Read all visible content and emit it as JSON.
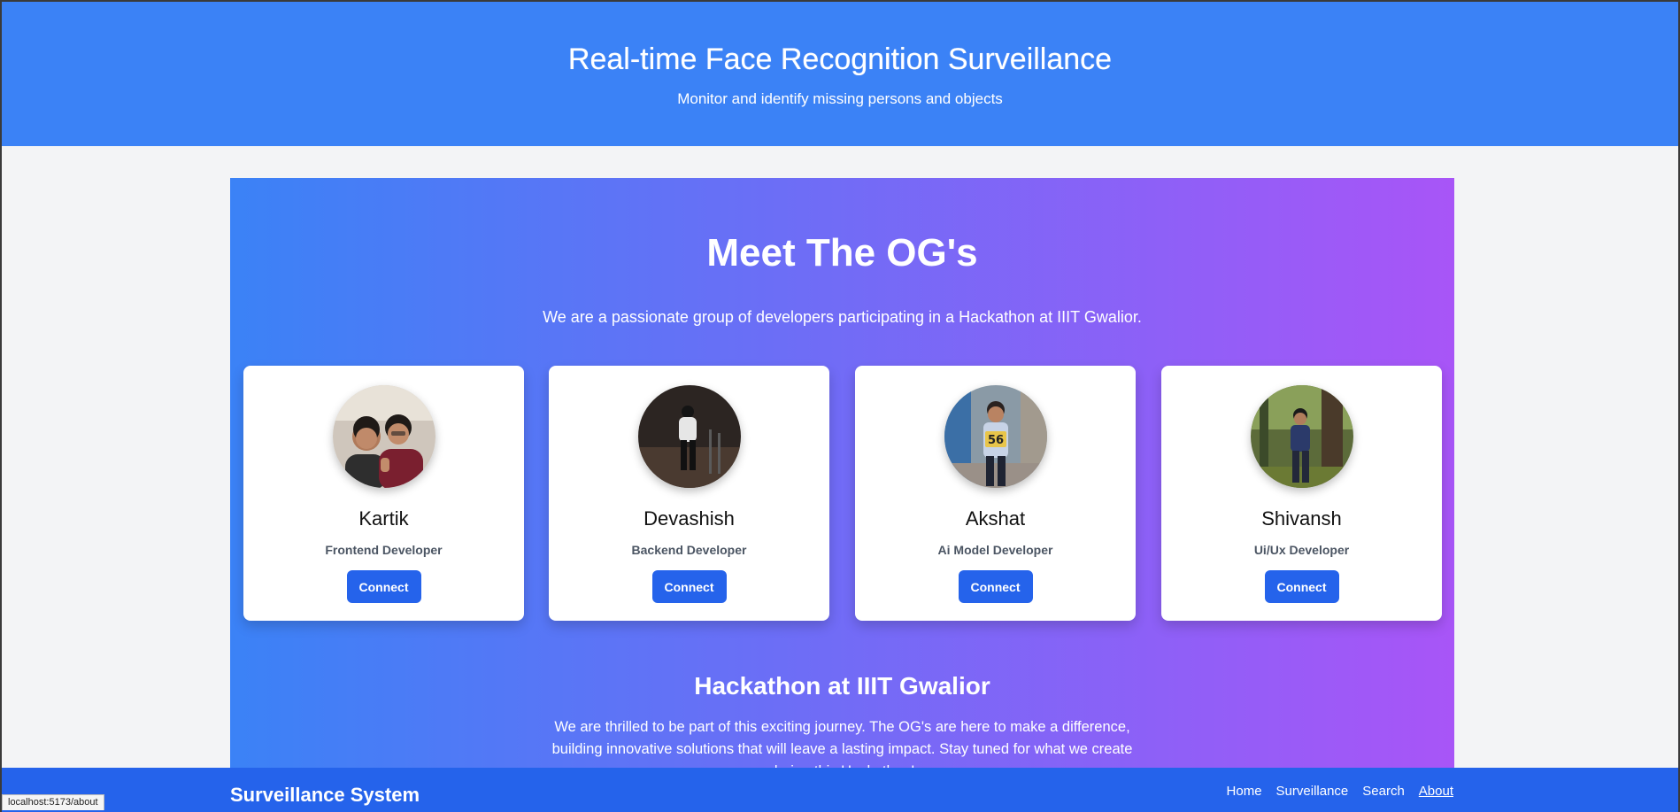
{
  "header": {
    "title": "Real-time Face Recognition Surveillance",
    "subtitle": "Monitor and identify missing persons and objects"
  },
  "team": {
    "heading": "Meet The OG's",
    "intro": "We are a passionate group of developers participating in a Hackathon at IIIT Gwalior.",
    "members": [
      {
        "name": "Kartik",
        "role": "Frontend Developer",
        "button": "Connect"
      },
      {
        "name": "Devashish",
        "role": "Backend Developer",
        "button": "Connect"
      },
      {
        "name": "Akshat",
        "role": "Ai Model Developer",
        "button": "Connect"
      },
      {
        "name": "Shivansh",
        "role": "Ui/Ux Developer",
        "button": "Connect"
      }
    ]
  },
  "hackathon": {
    "heading": "Hackathon at IIIT Gwalior",
    "text": "We are thrilled to be part of this exciting journey. The OG's are here to make a difference, building innovative solutions that will leave a lasting impact. Stay tuned for what we create during this Hackathon!"
  },
  "footer": {
    "brand": "Surveillance System",
    "nav": [
      "Home",
      "Surveillance",
      "Search",
      "About"
    ],
    "active": "About"
  },
  "status_url": "localhost:5173/about"
}
